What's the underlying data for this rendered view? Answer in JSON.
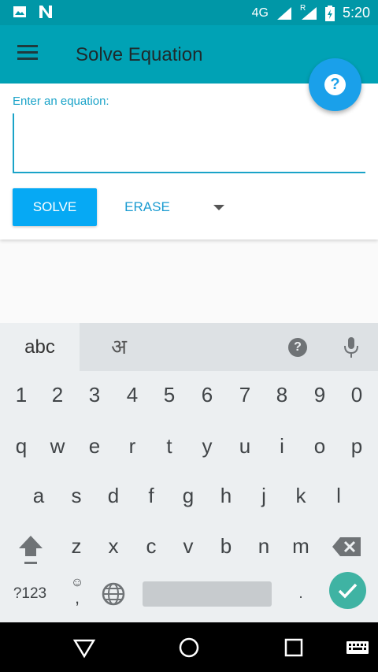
{
  "status_bar": {
    "network": "4G",
    "roaming": "R",
    "time": "5:20",
    "icons": [
      "image-icon",
      "n-logo-icon",
      "signal-icon",
      "roaming-signal-icon",
      "battery-charging-icon"
    ]
  },
  "app_bar": {
    "title": "Solve Equation",
    "menu_icon": "hamburger-menu-icon"
  },
  "fab": {
    "icon": "help-icon",
    "glyph": "?"
  },
  "equation": {
    "label": "Enter an equation:",
    "value": "",
    "placeholder": ""
  },
  "actions": {
    "solve_label": "SOLVE",
    "erase_label": "ERASE",
    "dropdown_icon": "dropdown-arrow-icon"
  },
  "keyboard": {
    "tab_abc": "abc",
    "tab_hindi": "अ",
    "help_glyph": "?",
    "number_row": [
      "1",
      "2",
      "3",
      "4",
      "5",
      "6",
      "7",
      "8",
      "9",
      "0"
    ],
    "row1": [
      "q",
      "w",
      "e",
      "r",
      "t",
      "y",
      "u",
      "i",
      "o",
      "p"
    ],
    "row2": [
      "a",
      "s",
      "d",
      "f",
      "g",
      "h",
      "j",
      "k",
      "l"
    ],
    "row3": [
      "z",
      "x",
      "c",
      "v",
      "b",
      "n",
      "m"
    ],
    "symbols_key": "?123",
    "comma_key": ",",
    "period_key": ".",
    "emoji_glyph": "☺"
  },
  "colors": {
    "status_bar": "#0097a7",
    "app_bar": "#00a2b5",
    "accent": "#1aa3c8",
    "solve_button": "#06a9f4",
    "fab": "#1aa0ea",
    "enter_key": "#3fb3a3"
  },
  "nav_bar": {
    "icons": [
      "back-icon",
      "home-icon",
      "recents-icon",
      "keyboard-switch-icon"
    ]
  }
}
